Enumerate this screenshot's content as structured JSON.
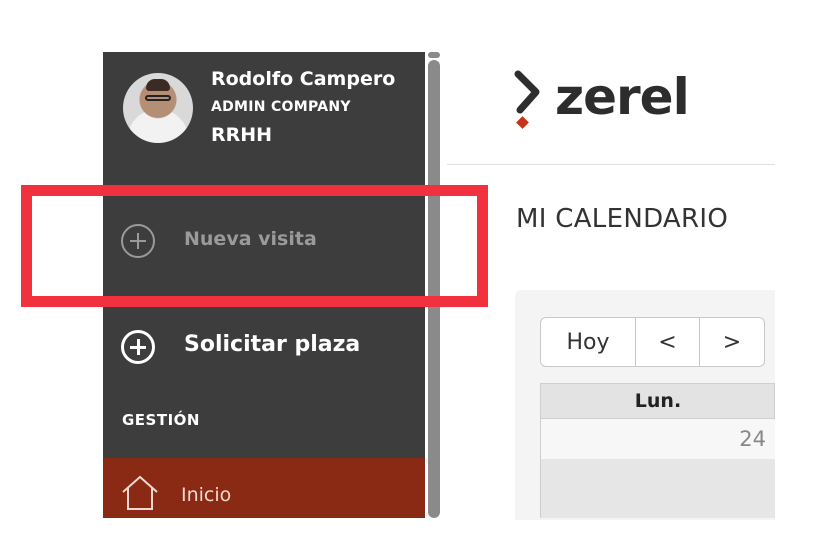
{
  "sidebar": {
    "user": {
      "name": "Rodolfo Campero",
      "company": "ADMIN COMPANY",
      "role": "RRHH"
    },
    "items": [
      {
        "label": "Nueva visita",
        "icon": "plus-circle-icon",
        "state": "disabled"
      },
      {
        "label": "Solicitar plaza",
        "icon": "plus-circle-icon"
      }
    ],
    "section_title": "GESTIÓN",
    "nav": [
      {
        "label": "Inicio",
        "icon": "home-icon",
        "active": true
      }
    ]
  },
  "header": {
    "logo_text": "zerel"
  },
  "main": {
    "page_title": "MI CALENDARIO",
    "calendar": {
      "buttons": {
        "today": "Hoy",
        "prev": "<",
        "next": ">"
      },
      "day_header": "Lun.",
      "day_number": "24"
    }
  },
  "colors": {
    "sidebar_bg": "#3d3d3d",
    "active_item_bg": "#8b2a14",
    "highlight": "#f2313f"
  }
}
